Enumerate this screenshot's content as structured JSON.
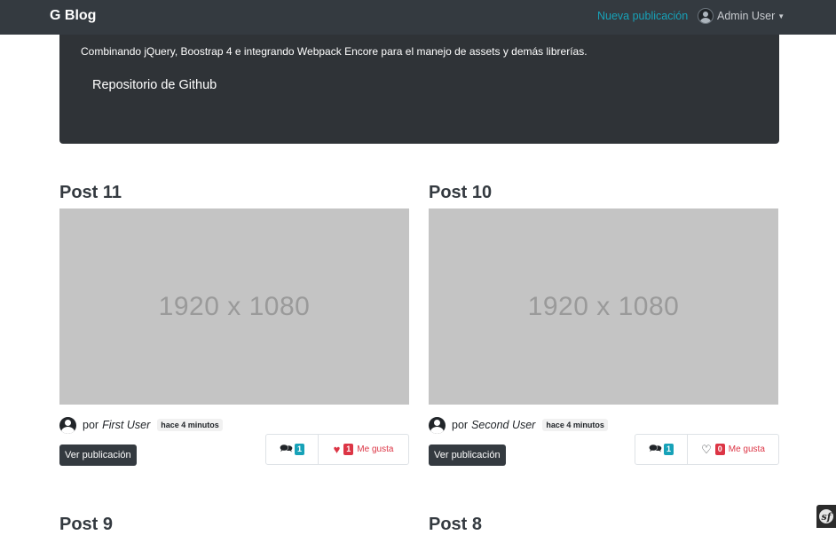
{
  "navbar": {
    "brand": "G Blog",
    "new_post": "Nueva publicación",
    "user": "Admin User"
  },
  "jumbotron": {
    "description": "Combinando jQuery, Boostrap 4 e integrando Webpack Encore para el manejo de assets y demás librerías.",
    "repo_link": "Repositorio de Github"
  },
  "posts": [
    {
      "title": "Post 11",
      "image_text": "1920 x 1080",
      "by": "por",
      "author": "First User",
      "time": "hace 4 minutos",
      "view_button": "Ver publicación",
      "comments": "1",
      "likes": "1",
      "likes_label": "Me gusta",
      "liked": true
    },
    {
      "title": "Post 10",
      "image_text": "1920 x 1080",
      "by": "por",
      "author": "Second User",
      "time": "hace 4 minutos",
      "view_button": "Ver publicación",
      "comments": "1",
      "likes": "0",
      "likes_label": "Me gusta",
      "liked": false
    }
  ],
  "next_posts": [
    "Post 9",
    "Post 8"
  ],
  "icons": {
    "comments": "comments-icon",
    "heart_filled": "heart-filled-icon",
    "heart_outline": "heart-outline-icon",
    "user": "user-circle-icon",
    "symfony": "symfony-logo-icon"
  },
  "colors": {
    "navbar": "#343a40",
    "accent_link": "#17a2b8",
    "danger": "#dc3545",
    "placeholder": "#c4c4c4"
  }
}
